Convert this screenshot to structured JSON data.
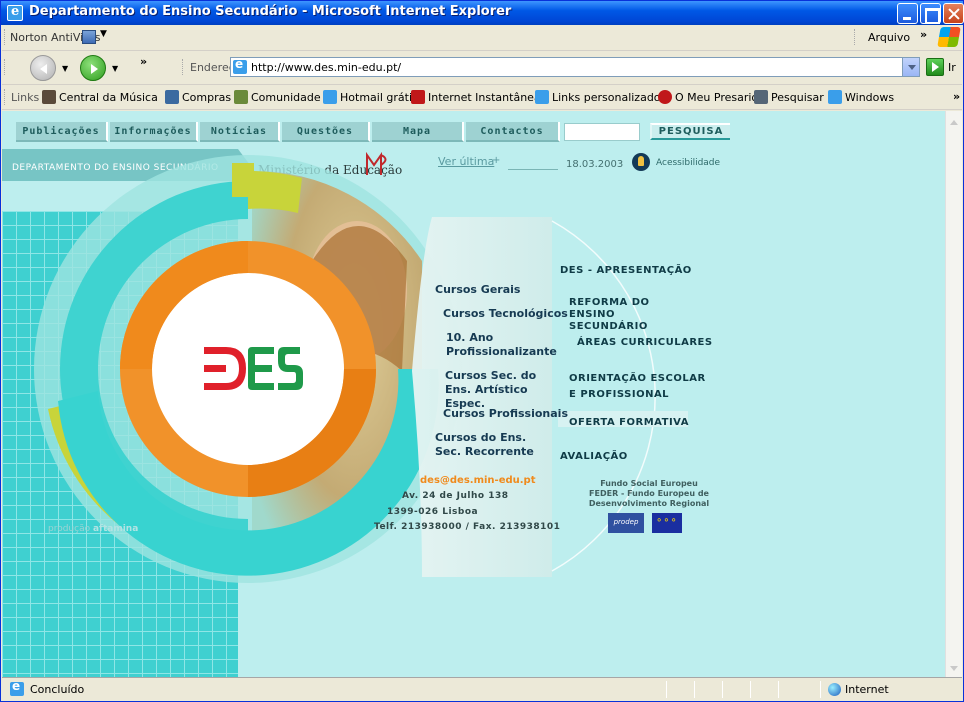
{
  "window": {
    "title": "Departamento do Ensino Secundário - Microsoft Internet Explorer"
  },
  "toolbar": {
    "norton": "Norton AntiVirus",
    "menu_arquivo": "Arquivo",
    "chevron": "»"
  },
  "address_bar": {
    "label": "Endereço",
    "url": "http://www.des.min-edu.pt/",
    "go_label": "Ir"
  },
  "links_bar": {
    "label": "Links",
    "items": [
      {
        "label": "Central da Música",
        "icon": "music-icon"
      },
      {
        "label": "Compras",
        "icon": "cart-icon"
      },
      {
        "label": "Comunidade",
        "icon": "community-icon"
      },
      {
        "label": "Hotmail grátis",
        "icon": "ie-page-icon"
      },
      {
        "label": "Internet Instantânea",
        "icon": "msn-icon"
      },
      {
        "label": "Links personalizados",
        "icon": "ie-page-icon"
      },
      {
        "label": "O Meu Presario",
        "icon": "presario-icon"
      },
      {
        "label": "Pesquisar",
        "icon": "search-icon"
      },
      {
        "label": "Windows",
        "icon": "ie-page-icon"
      }
    ]
  },
  "site_nav": {
    "items": [
      "Publicações",
      "Informações",
      "Notícias",
      "Questões",
      "Mapa",
      "Contactos"
    ],
    "search_button": "PESQUISA"
  },
  "header": {
    "department": "DEPARTAMENTO DO ENSINO SECUNDÁRIO",
    "ministry": "Ministério da Educação",
    "last_update_link": "Ver última",
    "last_update_date": "18.03.2003",
    "accessibility": "Acessibilidade"
  },
  "logo_text": "DES",
  "courses": [
    "Cursos Gerais",
    "Cursos Tecnológicos",
    "10. Ano Profissionalizante",
    "Cursos Sec. do Ens. Artístico Espec.",
    "Cursos Profissionais",
    "Cursos do Ens. Sec. Recorrente"
  ],
  "main_menu": [
    "DES - APRESENTAÇÃO",
    "REFORMA DO ENSINO SECUNDÁRIO",
    "ÁREAS CURRICULARES",
    "ORIENTAÇÃO ESCOLAR E PROFISSIONAL",
    "OFERTA FORMATIVA",
    "AVALIAÇÃO"
  ],
  "contact": {
    "email": "des@des.min-edu.pt",
    "address1": "Av. 24 de Julho 138",
    "address2": "1399-026 Lisboa",
    "phone": "Telf. 213938000 / Fax. 213938101"
  },
  "funding": {
    "line1": "Fundo Social Europeu",
    "line2": "FEDER - Fundo Europeu de",
    "line3": "Desenvolvimento Regional",
    "prodep": "prodep"
  },
  "credits": {
    "prefix": "produção",
    "name": "aftamina"
  },
  "status": {
    "text": "Concluído",
    "zone": "Internet"
  },
  "colors": {
    "teal_bg": "#bdeeee",
    "orange": "#f08a1c",
    "lime": "#c8d43a",
    "cyan": "#38d3d0",
    "logo_red": "#e0202a",
    "logo_green": "#1f9a4a"
  }
}
